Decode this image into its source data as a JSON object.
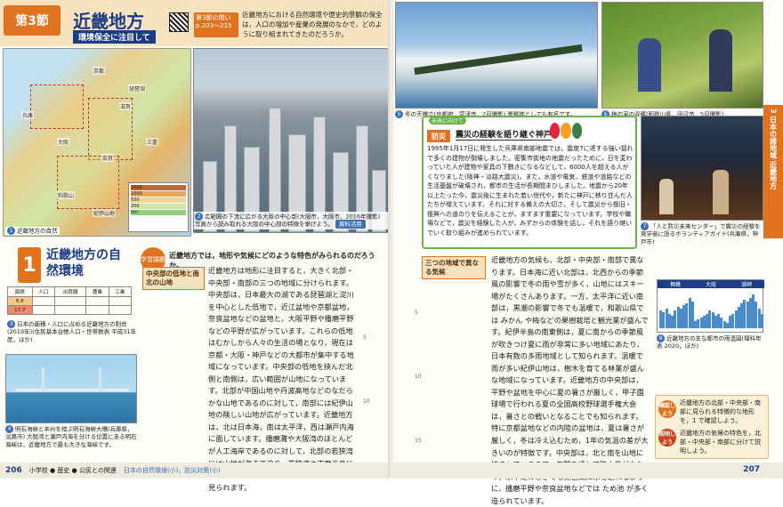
{
  "header": {
    "section_badge": "第3節",
    "title": "近畿地方",
    "subtitle": "環境保全に注目して",
    "goal_label": "第3節の問い p.203〜215",
    "goal_text": "近畿地方における自然環境や歴史的景観の保全は，人口の増加や産業の発展のなかで，どのように取り組まれてきたのだろうか。"
  },
  "map": {
    "labels": [
      "京都",
      "滋賀",
      "大阪",
      "奈良",
      "兵庫",
      "和歌山",
      "三重",
      "琵琶湖",
      "紀伊山地"
    ],
    "caption_num": "1",
    "caption": "近畿地方の自然",
    "legend": [
      "2000",
      "1000",
      "500",
      "200",
      "0m"
    ]
  },
  "city_photo": {
    "caption_num": "2",
    "caption": "広範囲の下流に広がる大阪の中心部(大阪市，大阪市，2016年撮影) 写真から読み取れる大阪の中心部の特徴を挙げよう。",
    "tag": "資料活用"
  },
  "section1": {
    "num": "1",
    "title": "近畿地方の自然環境",
    "kadai_label": "学習課題",
    "kadai_text": "近畿地方では，地形や気候にどのような特色がみられるのだろうか。",
    "topic1": "中央部の低地と南北の山地",
    "body1": "近畿地方は地形に注目すると，大きく北部・中央部・南部の三つの地域に分けられます。中央部は，日本最大の湖である琵琶湖と淀川を中心とした低地で，近江盆地や京都盆地，奈良盆地などの盆地と，大阪平野や播磨平野などの平野が広がっています。これらの低地はむかしから人々の生活の場となり，現在は京都・大阪・神戸などの大都市が集中する地域になっています。中央部の低地を挟んだ北側と南側は，広い範囲が山地になっています。北部が中国山地や丹波高地などのなだらかな山地であるのに対して，南部には紀伊山地の険しい山地が広がっています。近畿地方は，北は日本海，南は太平洋，西は瀬戸内海に面しています。播磨灘や大阪湾のほとんどが人工海岸であるのに対して，北部の若狭湾には山地が海まで迫り，若狭湾や志摩半島には，入り組んだ海岸線が特徴のリアス海岸が見られます。",
    "lnum5": "5",
    "lnum10": "10"
  },
  "stats_table": {
    "header": [
      "面積",
      "人口",
      "出荷額",
      "農業",
      "工業"
    ],
    "row1": [
      "8.8",
      "",
      "",
      "",
      ""
    ],
    "row2": [
      "17.7",
      "",
      "",
      "",
      ""
    ],
    "caption_num": "3",
    "caption": "日本の面積・人口に占める近畿地方の割合(2019年)(住民基本台帳人口・世帯数表 平成31年度，ほか)"
  },
  "bridge_photo": {
    "caption_num": "4",
    "caption": "明石海峡と本州を結ぶ明石海峡大橋(兵庫県，淡路市) 大阪湾と瀬戸内海を分ける位置にある明石海峡は，近畿地方で最も大きな海峡です。"
  },
  "footer_left": {
    "page": "206",
    "links": "小学校 ● 歴史 ● 公民との関連",
    "related": "日本の自然環境(小)，防災対策(小)"
  },
  "snow_photo": {
    "caption_num": "5",
    "caption": "冬の天橋立(京都府，宮津市，2月撮影) 景勝地としても有名です。"
  },
  "orchard_photo": {
    "caption_num": "6",
    "caption": "梅の実の収穫(和歌山県，田辺市，5月撮影)"
  },
  "side_tab": "3 日本の諸地域 近畿地方",
  "bousai": {
    "mirai_label": "未来に向けて",
    "tag": "防災",
    "title": "震災の経験を語り継ぐ神戸",
    "body": "1995年1月17日に発生した兵庫県南部地震では，震度7に達する強い揺れで多くの建物が倒壊しました。密集市街地の地震だったために，日を変わっていた人が建物や家具の下敷きになるなどして，6000人を超える人がくなりました(阪神・淡路大震災)。また，水道や電気，鉄道や道路などの生活基盤が破壊され，都市の生活が長期間まひしました。地震から20年以上たった今，震災後に生まれた若い世代や，新たに神戸に移り住んだ人たちが増えています。それに対する備えの大切さ，そして震災から復旧・復興への道のりを伝えることが，ますます重要になっています。学校や職場などで，震災を経験した人が，みずからの体験を話し，それを語り継いでいく取り組みが進められています。",
    "museum_caption_num": "7",
    "museum_caption": "「人と防災未来センター」で震災の経験を見学者に語るボランティアガイド(兵庫県，神戸市)"
  },
  "climate_section": {
    "topic": "三つの地域で異なる気候",
    "body": "近畿地方の気候も，北部・中央部・南部で異なります。日本海に近い北部は，北西からの季節風の影響で冬の雨や雪が多く，山地にはスキー場がたくさんあります。一方，太平洋に近い南部は，黒潮の影響で冬でも温暖で，和歌山県では みかん や梅などの果樹栽培と観光業が盛んです。紀伊半島の南東側は，夏に南からの季節風が吹きつけ夏に雨が非常に多い地域にあたり，日本有数の多雨地域として知られます。温暖で雨が多い紀伊山地は，樹木を育てる林業が盛んな地域になっています。近畿地方の中央部は，平野や盆地を中心に夏の暑さが厳しく，甲子園球場で行われる夏の全国高校野球選手権大会は，暑さとの戦いとなることでも知られます。特に京都盆地などの内陸の盆地は，夏は暑さが厳しく，冬は冷え込むため，1年の気温の差が大きいのが特徴です。中央部は，北と南を山地に挟まれているので，年間を通して降水量が少なく，水不足のときでも琵琶湖に水を送れるように，播磨平野や奈良盆地などでは ため池 が多く造られています。",
    "lnum5": "5",
    "lnum10": "10",
    "lnum15": "15"
  },
  "climate_chart": {
    "cities": [
      "舞鶴",
      "大阪",
      "潮岬"
    ],
    "caption_num": "8",
    "caption": "近畿地方の主な都市の雨温図(理科年表 2020，ほか)"
  },
  "check": {
    "tag1": "確認しよう",
    "text1": "近畿地方の北部・中央部・南部に見られる特徴的な地形を，1 で確認しよう。",
    "tag2": "説明しよう",
    "text2": "近畿地方の気候の特色を，北部・中央部・南部に分けて説明しよう。"
  },
  "footer_right": {
    "page": "207"
  }
}
